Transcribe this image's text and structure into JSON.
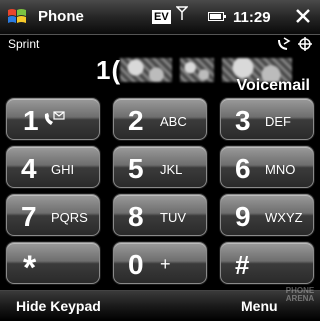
{
  "titlebar": {
    "app_title": "Phone",
    "network_badge": "EV",
    "clock": "11:29",
    "battery_level": 0.9
  },
  "info": {
    "carrier": "Sprint",
    "number_prefix": "1(",
    "voicemail": "Voicemail"
  },
  "keypad": {
    "keys": [
      {
        "digit": "1",
        "letters": ""
      },
      {
        "digit": "2",
        "letters": "ABC"
      },
      {
        "digit": "3",
        "letters": "DEF"
      },
      {
        "digit": "4",
        "letters": "GHI"
      },
      {
        "digit": "5",
        "letters": "JKL"
      },
      {
        "digit": "6",
        "letters": "MNO"
      },
      {
        "digit": "7",
        "letters": "PQRS"
      },
      {
        "digit": "8",
        "letters": "TUV"
      },
      {
        "digit": "9",
        "letters": "WXYZ"
      },
      {
        "digit": "*",
        "letters": ""
      },
      {
        "digit": "0",
        "letters": "+"
      },
      {
        "digit": "#",
        "letters": ""
      }
    ]
  },
  "softkeys": {
    "left": "Hide Keypad",
    "right": "Menu"
  },
  "watermark": {
    "line1": "PHONE",
    "line2": "ARENA"
  },
  "icons": {
    "start": "windows-logo-icon",
    "signal": "antenna-icon",
    "battery": "battery-icon",
    "close": "close-icon",
    "status": "call-forward-icon",
    "voicemail": "voicemail-icon"
  }
}
